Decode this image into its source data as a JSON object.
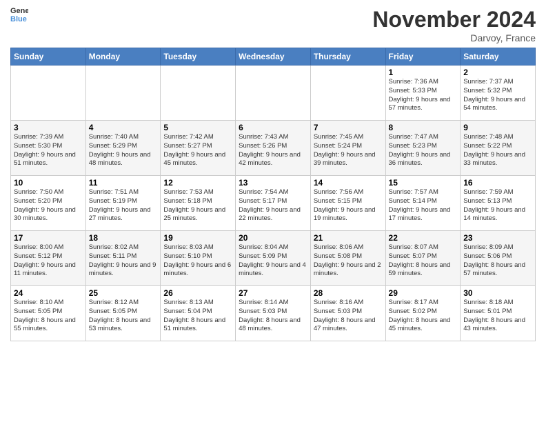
{
  "header": {
    "logo_line1": "General",
    "logo_line2": "Blue",
    "month_title": "November 2024",
    "location": "Darvoy, France"
  },
  "weekdays": [
    "Sunday",
    "Monday",
    "Tuesday",
    "Wednesday",
    "Thursday",
    "Friday",
    "Saturday"
  ],
  "weeks": [
    [
      {
        "day": "",
        "info": ""
      },
      {
        "day": "",
        "info": ""
      },
      {
        "day": "",
        "info": ""
      },
      {
        "day": "",
        "info": ""
      },
      {
        "day": "",
        "info": ""
      },
      {
        "day": "1",
        "info": "Sunrise: 7:36 AM\nSunset: 5:33 PM\nDaylight: 9 hours\nand 57 minutes."
      },
      {
        "day": "2",
        "info": "Sunrise: 7:37 AM\nSunset: 5:32 PM\nDaylight: 9 hours\nand 54 minutes."
      }
    ],
    [
      {
        "day": "3",
        "info": "Sunrise: 7:39 AM\nSunset: 5:30 PM\nDaylight: 9 hours\nand 51 minutes."
      },
      {
        "day": "4",
        "info": "Sunrise: 7:40 AM\nSunset: 5:29 PM\nDaylight: 9 hours\nand 48 minutes."
      },
      {
        "day": "5",
        "info": "Sunrise: 7:42 AM\nSunset: 5:27 PM\nDaylight: 9 hours\nand 45 minutes."
      },
      {
        "day": "6",
        "info": "Sunrise: 7:43 AM\nSunset: 5:26 PM\nDaylight: 9 hours\nand 42 minutes."
      },
      {
        "day": "7",
        "info": "Sunrise: 7:45 AM\nSunset: 5:24 PM\nDaylight: 9 hours\nand 39 minutes."
      },
      {
        "day": "8",
        "info": "Sunrise: 7:47 AM\nSunset: 5:23 PM\nDaylight: 9 hours\nand 36 minutes."
      },
      {
        "day": "9",
        "info": "Sunrise: 7:48 AM\nSunset: 5:22 PM\nDaylight: 9 hours\nand 33 minutes."
      }
    ],
    [
      {
        "day": "10",
        "info": "Sunrise: 7:50 AM\nSunset: 5:20 PM\nDaylight: 9 hours\nand 30 minutes."
      },
      {
        "day": "11",
        "info": "Sunrise: 7:51 AM\nSunset: 5:19 PM\nDaylight: 9 hours\nand 27 minutes."
      },
      {
        "day": "12",
        "info": "Sunrise: 7:53 AM\nSunset: 5:18 PM\nDaylight: 9 hours\nand 25 minutes."
      },
      {
        "day": "13",
        "info": "Sunrise: 7:54 AM\nSunset: 5:17 PM\nDaylight: 9 hours\nand 22 minutes."
      },
      {
        "day": "14",
        "info": "Sunrise: 7:56 AM\nSunset: 5:15 PM\nDaylight: 9 hours\nand 19 minutes."
      },
      {
        "day": "15",
        "info": "Sunrise: 7:57 AM\nSunset: 5:14 PM\nDaylight: 9 hours\nand 17 minutes."
      },
      {
        "day": "16",
        "info": "Sunrise: 7:59 AM\nSunset: 5:13 PM\nDaylight: 9 hours\nand 14 minutes."
      }
    ],
    [
      {
        "day": "17",
        "info": "Sunrise: 8:00 AM\nSunset: 5:12 PM\nDaylight: 9 hours\nand 11 minutes."
      },
      {
        "day": "18",
        "info": "Sunrise: 8:02 AM\nSunset: 5:11 PM\nDaylight: 9 hours\nand 9 minutes."
      },
      {
        "day": "19",
        "info": "Sunrise: 8:03 AM\nSunset: 5:10 PM\nDaylight: 9 hours\nand 6 minutes."
      },
      {
        "day": "20",
        "info": "Sunrise: 8:04 AM\nSunset: 5:09 PM\nDaylight: 9 hours\nand 4 minutes."
      },
      {
        "day": "21",
        "info": "Sunrise: 8:06 AM\nSunset: 5:08 PM\nDaylight: 9 hours\nand 2 minutes."
      },
      {
        "day": "22",
        "info": "Sunrise: 8:07 AM\nSunset: 5:07 PM\nDaylight: 8 hours\nand 59 minutes."
      },
      {
        "day": "23",
        "info": "Sunrise: 8:09 AM\nSunset: 5:06 PM\nDaylight: 8 hours\nand 57 minutes."
      }
    ],
    [
      {
        "day": "24",
        "info": "Sunrise: 8:10 AM\nSunset: 5:05 PM\nDaylight: 8 hours\nand 55 minutes."
      },
      {
        "day": "25",
        "info": "Sunrise: 8:12 AM\nSunset: 5:05 PM\nDaylight: 8 hours\nand 53 minutes."
      },
      {
        "day": "26",
        "info": "Sunrise: 8:13 AM\nSunset: 5:04 PM\nDaylight: 8 hours\nand 51 minutes."
      },
      {
        "day": "27",
        "info": "Sunrise: 8:14 AM\nSunset: 5:03 PM\nDaylight: 8 hours\nand 48 minutes."
      },
      {
        "day": "28",
        "info": "Sunrise: 8:16 AM\nSunset: 5:03 PM\nDaylight: 8 hours\nand 47 minutes."
      },
      {
        "day": "29",
        "info": "Sunrise: 8:17 AM\nSunset: 5:02 PM\nDaylight: 8 hours\nand 45 minutes."
      },
      {
        "day": "30",
        "info": "Sunrise: 8:18 AM\nSunset: 5:01 PM\nDaylight: 8 hours\nand 43 minutes."
      }
    ]
  ]
}
